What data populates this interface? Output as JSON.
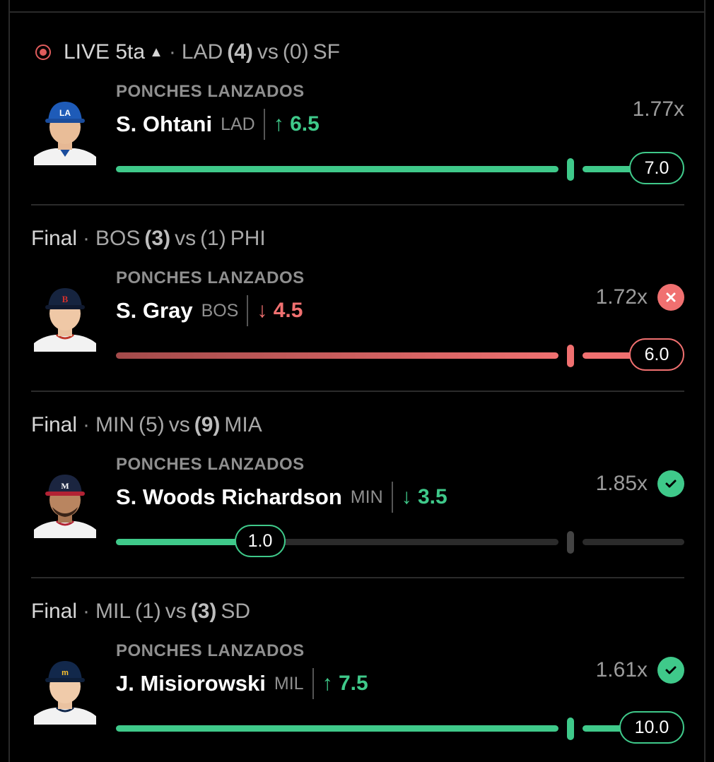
{
  "colors": {
    "green": "#3fc98a",
    "red": "#f07070",
    "track_empty": "#2b2b2b"
  },
  "props": [
    {
      "status": "LIVE 5ta",
      "live": true,
      "home_team": "LAD",
      "home_score": "(4)",
      "away_score": "(0)",
      "away_team": "SF",
      "market": "PONCHES LANZADOS",
      "player": "S. Ohtani",
      "team": "LAD",
      "direction": "↑",
      "line": "6.5",
      "odds": "1.77x",
      "result": "",
      "current": "7.0",
      "progress": 1.0,
      "tone": "green"
    },
    {
      "status": "Final",
      "live": false,
      "home_team": "BOS",
      "home_score": "(3)",
      "away_score": "(1)",
      "away_team": "PHI",
      "market": "PONCHES LANZADOS",
      "player": "S. Gray",
      "team": "BOS",
      "direction": "↓",
      "line": "4.5",
      "odds": "1.72x",
      "result": "lose",
      "current": "6.0",
      "progress": 1.0,
      "tone": "red"
    },
    {
      "status": "Final",
      "live": false,
      "home_team": "MIN",
      "home_score": "(5)",
      "away_score": "(9)",
      "away_team": "MIA",
      "market": "PONCHES LANZADOS",
      "player": "S. Woods Richardson",
      "team": "MIN",
      "direction": "↓",
      "line": "3.5",
      "odds": "1.85x",
      "result": "win",
      "current": "1.0",
      "progress": 0.25,
      "tone": "green"
    },
    {
      "status": "Final",
      "live": false,
      "home_team": "MIL",
      "home_score": "(1)",
      "away_score": "(3)",
      "away_team": "SD",
      "market": "PONCHES LANZADOS",
      "player": "J. Misiorowski",
      "team": "MIL",
      "direction": "↑",
      "line": "7.5",
      "odds": "1.61x",
      "result": "win",
      "current": "10.0",
      "progress": 1.0,
      "tone": "green"
    }
  ]
}
